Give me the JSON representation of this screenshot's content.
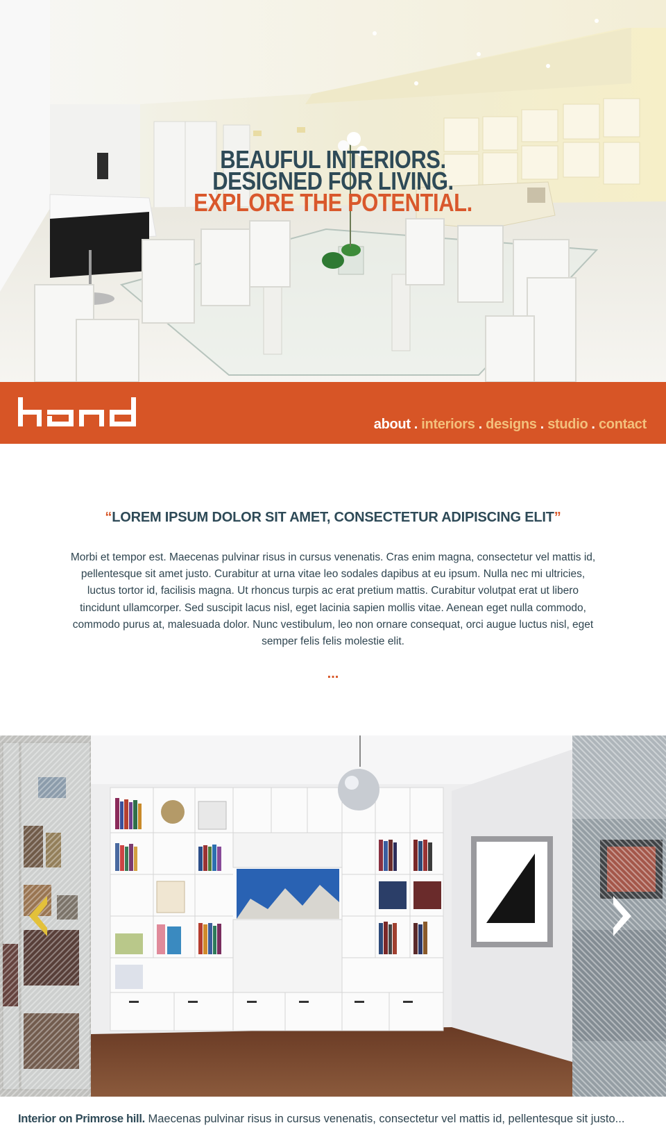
{
  "hero": {
    "line1": "BEAUFUL INTERIORS.",
    "line2": "DESIGNED FOR LIVING.",
    "line3": "EXPLORE THE POTENTIAL."
  },
  "brand": {
    "logo_icon": "hand-logo",
    "accent_color": "#d75526",
    "dark_color": "#2e4a57",
    "nav_link_color": "#f3c07c"
  },
  "nav": {
    "items": [
      "about",
      "interiors",
      "designs",
      "studio",
      "contact"
    ],
    "separator": ".",
    "active": "about"
  },
  "intro": {
    "quote_open": "“",
    "quote": "LOREM IPSUM DOLOR SIT AMET, CONSECTETUR ADIPISCING ELIT",
    "quote_close": "”",
    "body": "Morbi et tempor est. Maecenas pulvinar risus in cursus venenatis. Cras enim magna, consectetur vel mattis id, pellentesque sit amet justo. Curabitur at urna vitae leo sodales dapibus at eu ipsum. Nulla nec mi ultricies, luctus tortor id, facilisis magna. Ut rhoncus turpis ac erat pretium mattis. Curabitur volutpat erat ut libero tincidunt ullamcorper. Sed suscipit lacus nisl, eget lacinia sapien mollis vitae. Aenean eget nulla commodo, commodo purus at, malesuada dolor. Nunc vestibulum, leo non ornare consequat, orci augue luctus nisl, eget semper felis felis molestie elit.",
    "more": "..."
  },
  "carousel": {
    "prev_icon": "chevron-left-icon",
    "next_icon": "chevron-right-icon"
  },
  "caption": {
    "title": "Interior on Primrose hill.",
    "text": " Maecenas pulvinar risus in cursus venenatis, consectetur vel mattis id, pellentesque sit justo..."
  }
}
